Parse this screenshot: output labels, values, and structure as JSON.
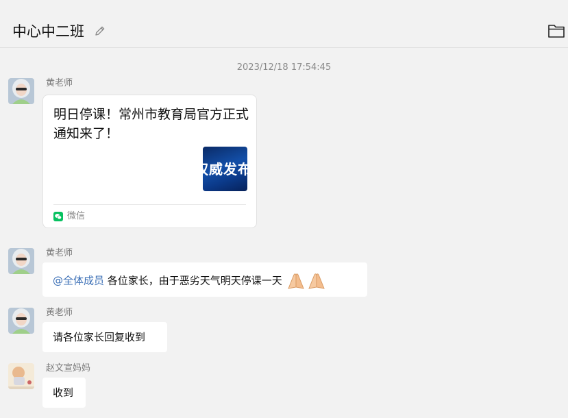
{
  "header": {
    "title": "中心中二班",
    "icons": {
      "edit": "pencil-icon",
      "folder": "folder-icon"
    }
  },
  "chat": {
    "timestamp": "2023/12/18 17:54:45",
    "messages": [
      {
        "sender": "黄老师",
        "type": "link-card",
        "card_title": "明日停课！常州市教育局官方正式通知来了！",
        "card_thumb_text": "权威发布",
        "card_source": "微信"
      },
      {
        "sender": "黄老师",
        "type": "text",
        "mention": "@全体成员",
        "text": "各位家长，由于恶劣天气明天停课一天",
        "emoji": "🙏🙏"
      },
      {
        "sender": "黄老师",
        "type": "text",
        "text": "请各位家长回复收到"
      },
      {
        "sender": "赵文宣妈妈",
        "type": "text",
        "text": "收到"
      }
    ]
  },
  "colors": {
    "background": "#f2f2f2",
    "bubble": "#ffffff",
    "mention": "#3b6fb6",
    "wechat_green": "#07c160"
  }
}
